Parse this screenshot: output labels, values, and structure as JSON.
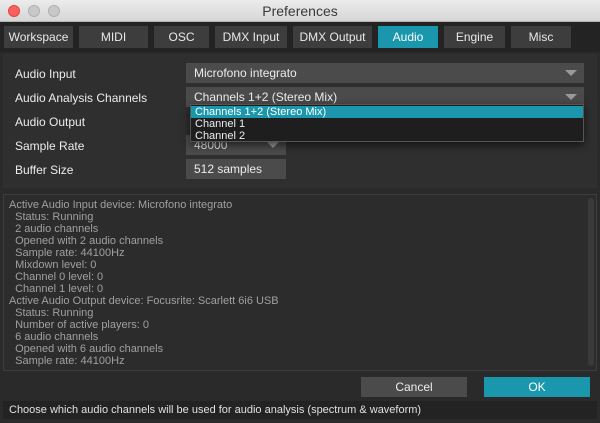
{
  "window": {
    "title": "Preferences"
  },
  "tabs": [
    {
      "label": "Workspace"
    },
    {
      "label": "MIDI"
    },
    {
      "label": "OSC"
    },
    {
      "label": "DMX Input"
    },
    {
      "label": "DMX Output"
    },
    {
      "label": "Audio",
      "active": true
    },
    {
      "label": "Engine"
    },
    {
      "label": "Misc"
    }
  ],
  "settings": {
    "audio_input": {
      "label": "Audio Input",
      "value": "Microfono integrato"
    },
    "analysis_channels": {
      "label": "Audio Analysis Channels",
      "value": "Channels 1+2 (Stereo Mix)",
      "options": [
        "Channels 1+2 (Stereo Mix)",
        "Channel 1",
        "Channel 2"
      ]
    },
    "audio_output": {
      "label": "Audio Output"
    },
    "sample_rate": {
      "label": "Sample Rate",
      "value": "48000"
    },
    "buffer_size": {
      "label": "Buffer Size",
      "value": "512 samples"
    }
  },
  "log": [
    "Active Audio Input device: Microfono integrato",
    "  Status: Running",
    "  2 audio channels",
    "  Opened with 2 audio channels",
    "  Sample rate: 44100Hz",
    "  Mixdown level: 0",
    "  Channel 0 level: 0",
    "  Channel 1 level: 0",
    "Active Audio Output device: Focusrite: Scarlett 6i6 USB",
    "  Status: Running",
    "  Number of active players: 0",
    "  6 audio channels",
    "  Opened with 6 audio channels",
    "  Sample rate: 44100Hz"
  ],
  "buttons": {
    "cancel": "Cancel",
    "ok": "OK"
  },
  "status": "Choose which audio channels will be used for audio analysis (spectrum & waveform)",
  "colors": {
    "accent": "#1a97ad",
    "background": "#2a2a2a"
  }
}
